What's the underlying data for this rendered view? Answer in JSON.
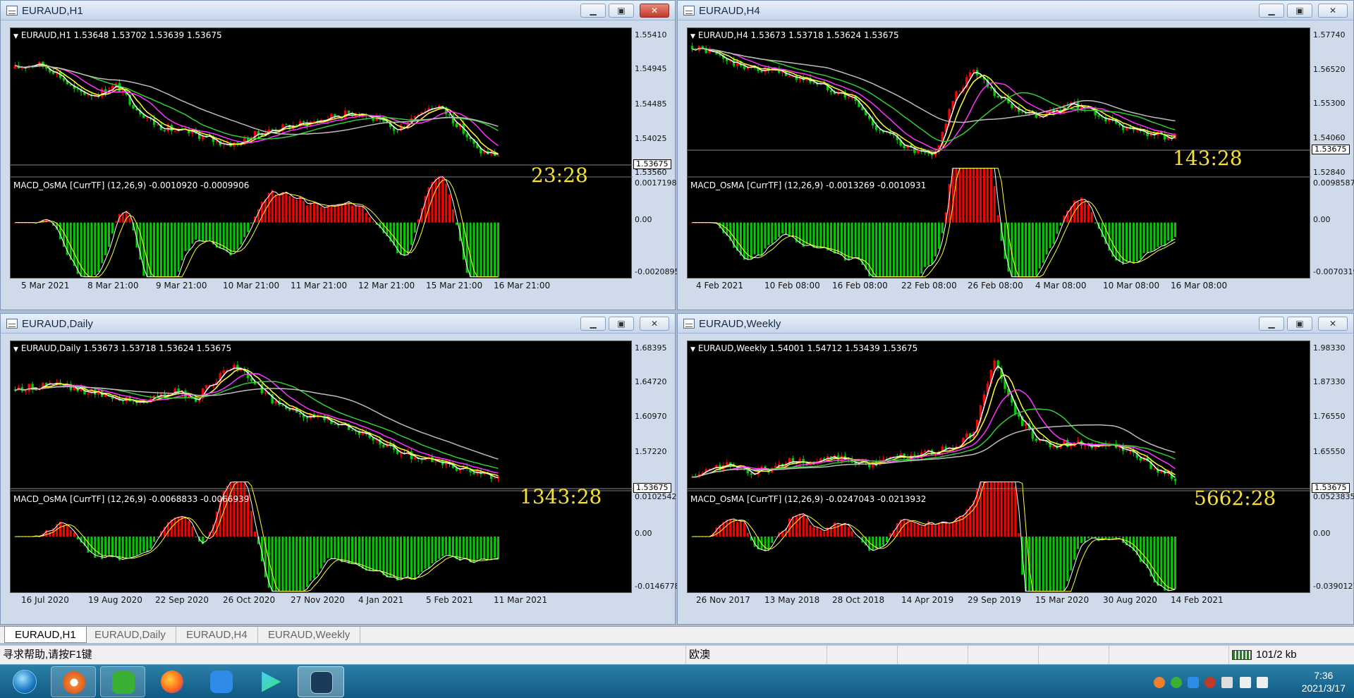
{
  "windows": [
    {
      "id": "h1",
      "title": "EURAUD,H1",
      "close_active": true,
      "ohlc": "EURAUD,H1  1.53648 1.53702 1.53639 1.53675",
      "price_ticks": [
        "1.55410",
        "1.54945",
        "1.54485",
        "1.54025",
        "1.53560"
      ],
      "current_price": "1.53675",
      "timer": "23:28",
      "macd_label": "MACD_OsMA [CurrTF] (12,26,9) -0.0010920 -0.0009906",
      "macd_ticks": [
        "0.0017198",
        "0.00",
        "-0.0020895"
      ],
      "dates": [
        "5 Mar 2021",
        "8 Mar 21:00",
        "9 Mar 21:00",
        "10 Mar 21:00",
        "11 Mar 21:00",
        "12 Mar 21:00",
        "15 Mar 21:00",
        "16 Mar 21:00"
      ]
    },
    {
      "id": "h4",
      "title": "EURAUD,H4",
      "close_active": false,
      "ohlc": "EURAUD,H4  1.53673 1.53718 1.53624 1.53675",
      "price_ticks": [
        "1.57740",
        "1.56520",
        "1.55300",
        "1.54060",
        "1.52840"
      ],
      "current_price": "1.53675",
      "timer": "143:28",
      "macd_label": "MACD_OsMA [CurrTF] (12,26,9) -0.0013269 -0.0010931",
      "macd_ticks": [
        "0.0098587",
        "0.00",
        "-0.0070319"
      ],
      "dates": [
        "4 Feb 2021",
        "10 Feb 08:00",
        "16 Feb 08:00",
        "22 Feb 08:00",
        "26 Feb 08:00",
        "4 Mar 08:00",
        "10 Mar 08:00",
        "16 Mar 08:00"
      ]
    },
    {
      "id": "daily",
      "title": "EURAUD,Daily",
      "close_active": false,
      "ohlc": "EURAUD,Daily  1.53673 1.53718 1.53624 1.53675",
      "price_ticks": [
        "1.68395",
        "1.64720",
        "1.60970",
        "1.57220"
      ],
      "current_price": "1.53675",
      "timer": "1343:28",
      "macd_label": "MACD_OsMA [CurrTF] (12,26,9) -0.0068833 -0.0066939",
      "macd_ticks": [
        "0.0102542",
        "0.00",
        "-0.0146778"
      ],
      "dates": [
        "16 Jul 2020",
        "19 Aug 2020",
        "22 Sep 2020",
        "26 Oct 2020",
        "27 Nov 2020",
        "4 Jan 2021",
        "5 Feb 2021",
        "11 Mar 2021"
      ]
    },
    {
      "id": "weekly",
      "title": "EURAUD,Weekly",
      "close_active": false,
      "ohlc": "EURAUD,Weekly  1.54001 1.54712 1.53439 1.53675",
      "price_ticks": [
        "1.98330",
        "1.87330",
        "1.76550",
        "1.65550"
      ],
      "current_price": "1.53675",
      "timer": "5662:28",
      "macd_label": "MACD_OsMA [CurrTF] (12,26,9) -0.0247043 -0.0213932",
      "macd_ticks": [
        "0.0523835",
        "0.00",
        "-0.0390127"
      ],
      "dates": [
        "26 Nov 2017",
        "13 May 2018",
        "28 Oct 2018",
        "14 Apr 2019",
        "29 Sep 2019",
        "15 Mar 2020",
        "30 Aug 2020",
        "14 Feb 2021"
      ]
    }
  ],
  "tabs": [
    "EURAUD,H1",
    "EURAUD,Daily",
    "EURAUD,H4",
    "EURAUD,Weekly"
  ],
  "status": {
    "help": "寻求帮助,请按F1键",
    "profile": "欧澳",
    "traffic": "101/2 kb"
  },
  "taskbar": {
    "time": "7:36",
    "date": "2021/3/17",
    "apps": [
      "start-orb",
      "browser-swirl",
      "wechat",
      "firefox",
      "feather-app",
      "player",
      "trading-terminal"
    ]
  },
  "colors": {
    "bull": "#ff0000",
    "bear": "#00cc00",
    "ma_yellow": "#ffff33",
    "ma_magenta": "#ff33ff",
    "ma_green": "#33cc33",
    "ma_gray": "#bbbbbb",
    "timer": "#f5e03a"
  }
}
